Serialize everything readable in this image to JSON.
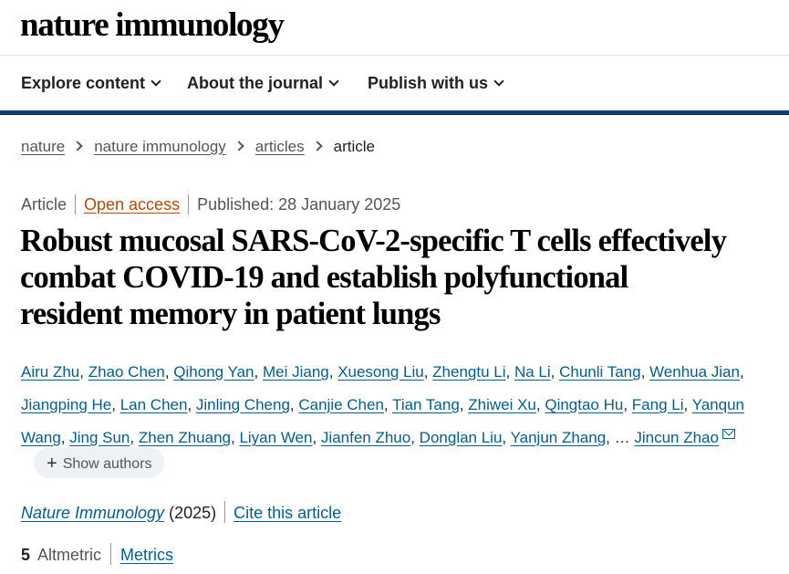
{
  "site": {
    "logo": "nature immunology"
  },
  "nav": {
    "items": [
      {
        "label": "Explore content"
      },
      {
        "label": "About the journal"
      },
      {
        "label": "Publish with us"
      }
    ]
  },
  "breadcrumb": [
    "nature",
    "nature immunology",
    "articles",
    "article"
  ],
  "meta": {
    "type": "Article",
    "access": "Open access",
    "published": "Published: 28 January 2025"
  },
  "title_lines": [
    "Robust mucosal SARS-CoV-2-specific T cells effectively",
    "combat COVID-19 and establish polyfunctional",
    "resident memory in patient lungs"
  ],
  "authors": [
    "Airu Zhu",
    "Zhao Chen",
    "Qihong Yan",
    "Mei Jiang",
    "Xuesong Liu",
    "Zhengtu Li",
    "Na Li",
    "Chunli Tang",
    "Wenhua Jian",
    "Jiangping He",
    "Lan Chen",
    "Jinling Cheng",
    "Canjie Chen",
    "Tian Tang",
    "Zhiwei Xu",
    "Qingtao Hu",
    "Fang Li",
    "Yanqun Wang",
    "Jing Sun",
    "Zhen Zhuang",
    "Liyan Wen",
    "Jianfen Zhuo",
    "Donglan Liu",
    "Yanjun Zhang"
  ],
  "authors_ellipsis": "…",
  "corresponding_author": "Jincun Zhao",
  "show_authors_label": "Show authors",
  "journal": {
    "name": "Nature Immunology",
    "year": "(2025)",
    "cite": "Cite this article"
  },
  "metrics": {
    "altmetric_value": "5",
    "altmetric_label": "Altmetric",
    "metrics_link": "Metrics"
  },
  "colors": {
    "link": "#025e8d",
    "open_access": "#b14a0b",
    "nav_bar": "#0c3e7b"
  }
}
